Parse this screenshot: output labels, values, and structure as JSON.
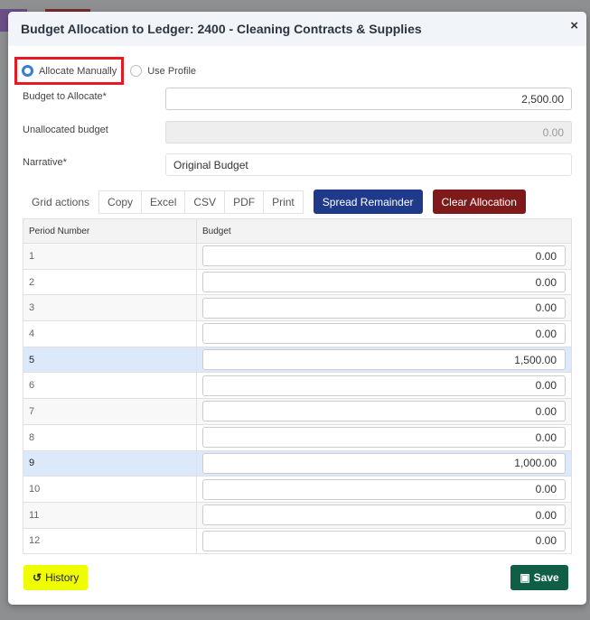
{
  "modal": {
    "title": "Budget Allocation to Ledger: 2400 - Cleaning Contracts & Supplies",
    "close": "×"
  },
  "mode": {
    "option1": "Allocate Manually",
    "option2": "Use Profile",
    "selected": "Allocate Manually"
  },
  "form": {
    "budget_label": "Budget to Allocate*",
    "budget_value": "2,500.00",
    "unallocated_label": "Unallocated budget",
    "unallocated_value": "0.00",
    "narrative_label": "Narrative*",
    "narrative_value": "Original Budget"
  },
  "grid_actions": {
    "label": "Grid actions",
    "buttons": [
      "Copy",
      "Excel",
      "CSV",
      "PDF",
      "Print"
    ],
    "spread": "Spread Remainder",
    "clear": "Clear Allocation"
  },
  "table": {
    "headers": [
      "Period Number",
      "Budget"
    ],
    "rows": [
      {
        "period": "1",
        "budget": "0.00"
      },
      {
        "period": "2",
        "budget": "0.00"
      },
      {
        "period": "3",
        "budget": "0.00"
      },
      {
        "period": "4",
        "budget": "0.00"
      },
      {
        "period": "5",
        "budget": "1,500.00"
      },
      {
        "period": "6",
        "budget": "0.00"
      },
      {
        "period": "7",
        "budget": "0.00"
      },
      {
        "period": "8",
        "budget": "0.00"
      },
      {
        "period": "9",
        "budget": "1,000.00"
      },
      {
        "period": "10",
        "budget": "0.00"
      },
      {
        "period": "11",
        "budget": "0.00"
      },
      {
        "period": "12",
        "budget": "0.00"
      }
    ]
  },
  "footer": {
    "history": "History",
    "save": "Save"
  },
  "colors": {
    "highlight_row": "#dce9fb",
    "spread": "#1f3a8a",
    "clear": "#7f1a1a",
    "history": "#f0fc00",
    "save": "#0f5e45"
  }
}
